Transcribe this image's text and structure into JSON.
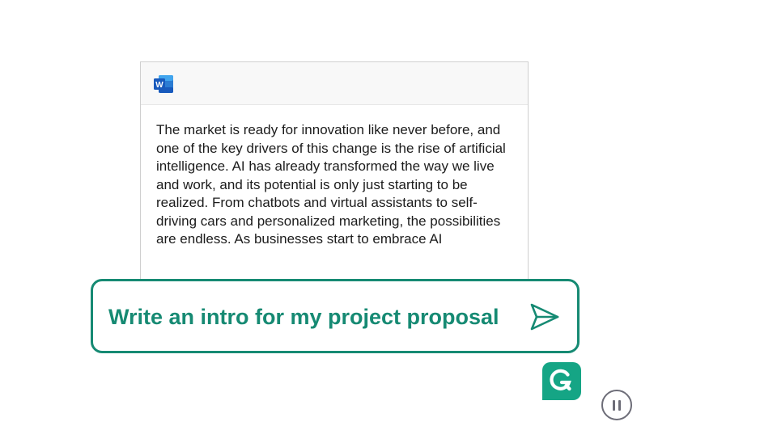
{
  "document": {
    "app_icon": "microsoft-word-icon",
    "app_icon_letter": "W",
    "text": "The market is ready for innovation like never before, and one of the key drivers of this change is the rise of artificial intelligence. AI has already transformed the way we live and work, and its potential is only just starting to be realized. From chatbots and virtual assistants to self-driving cars and personalized marketing, the possibilities are endless. As businesses start to embrace AI"
  },
  "prompt": {
    "text": "Write an intro for my project proposal",
    "send_icon": "send-icon"
  },
  "brand": {
    "logo": "grammarly-logo",
    "accent_color": "#168a73",
    "logo_color": "#15a585"
  },
  "controls": {
    "pause_icon": "pause-icon"
  }
}
